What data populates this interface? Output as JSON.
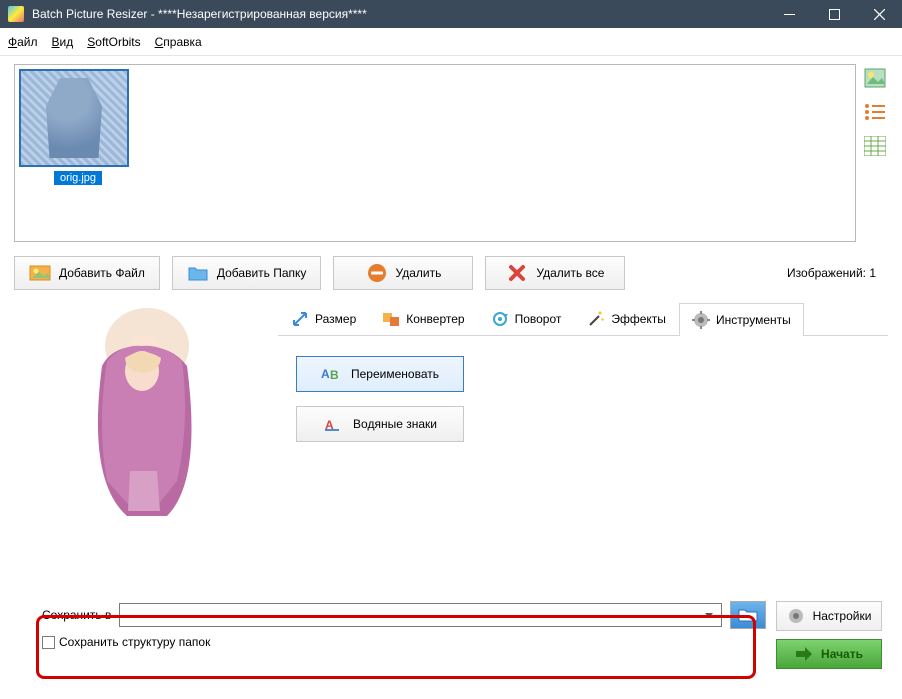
{
  "window": {
    "title": "Batch Picture Resizer - ****Незарегистрированная версия****"
  },
  "menu": {
    "file": "Файл",
    "view": "Вид",
    "softorbits": "SoftOrbits",
    "help": "Справка"
  },
  "thumb": {
    "filename": "orig.jpg"
  },
  "toolbar": {
    "add_file": "Добавить Файл",
    "add_folder": "Добавить Папку",
    "delete": "Удалить",
    "delete_all": "Удалить все"
  },
  "image_count_label": "Изображений: 1",
  "tabs": {
    "size": "Размер",
    "converter": "Конвертер",
    "rotate": "Поворот",
    "effects": "Эффекты",
    "tools": "Инструменты"
  },
  "tools": {
    "rename": "Переименовать",
    "watermark": "Водяные знаки"
  },
  "save": {
    "label": "Сохранить в",
    "keep_folders": "Сохранить структуру папок"
  },
  "actions": {
    "settings": "Настройки",
    "start": "Начать"
  }
}
